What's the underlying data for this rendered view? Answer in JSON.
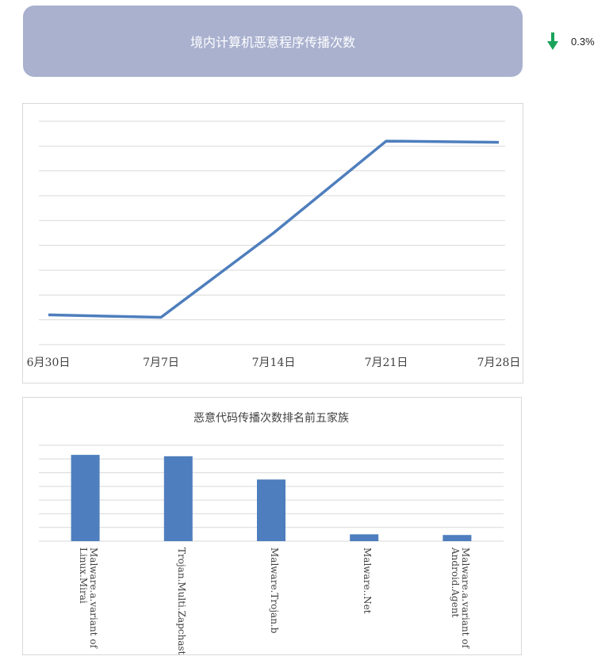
{
  "banner": {
    "title": "境内计算机恶意程序传播次数"
  },
  "trend": {
    "direction": "down",
    "value": "0.3%",
    "color": "#19a35a",
    "icon": "arrow-down-icon"
  },
  "chart_data": [
    {
      "type": "line",
      "title": "",
      "x": [
        "6月30日",
        "7月7日",
        "7月14日",
        "7月21日",
        "7月28日"
      ],
      "series": [
        {
          "values": [
            1.2,
            1.1,
            4.5,
            8.2,
            8.15
          ],
          "color": "#4e7ebd"
        }
      ],
      "ylim": [
        0,
        9
      ],
      "gridlines": 9,
      "grid": true,
      "y_tick_labels_shown": false
    },
    {
      "type": "bar",
      "title": "恶意代码传播次数排名前五家族",
      "categories": [
        [
          "Malware.a.variant of",
          "Linux.Mirai"
        ],
        [
          "Trojan.Multi.Zapchast"
        ],
        [
          "Malware.Trojan.b"
        ],
        [
          "Malware..Net"
        ],
        [
          "Malware.a.variant of",
          "Android.Agent"
        ]
      ],
      "values": [
        6.3,
        6.2,
        4.5,
        0.5,
        0.45
      ],
      "ylim": [
        0,
        7
      ],
      "gridlines": 7,
      "grid": true,
      "color": "#4e7ebd",
      "y_tick_labels_shown": false
    }
  ]
}
